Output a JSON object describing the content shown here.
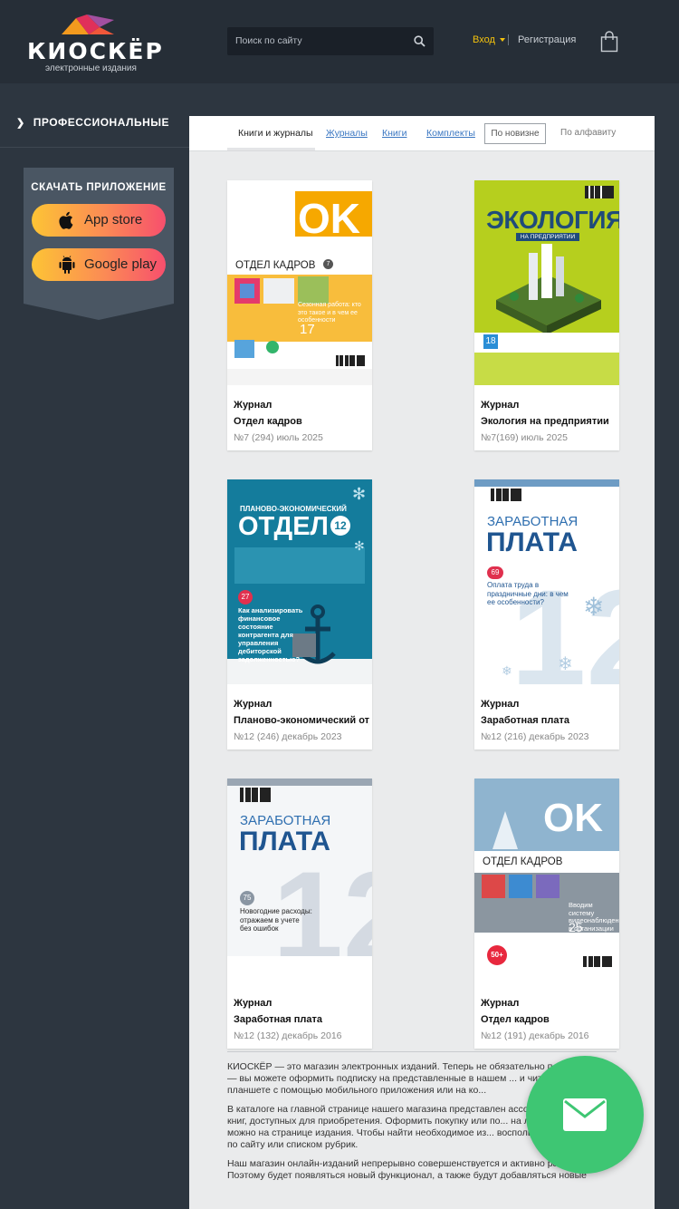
{
  "header": {
    "logo_text": "КИОСКЁР",
    "logo_sub": "электронные издания",
    "search_placeholder": "Поиск по сайту",
    "login": "Вход",
    "register": "Регистрация"
  },
  "sidebar": {
    "category": "ПРОФЕССИОНАЛЬНЫЕ",
    "app_title": "СКАЧАТЬ ПРИЛОЖЕНИЕ",
    "app_store": "App store",
    "google_play": "Google play"
  },
  "tabs": {
    "active": "Книги и журналы",
    "journals": "Журналы",
    "books": "Книги",
    "kits": "Комплекты",
    "sort_new": "По новизне",
    "sort_alpha": "По алфавиту"
  },
  "products": [
    {
      "type": "Журнал",
      "title": "Отдел кадров",
      "issue": "№7 (294) июль 2025",
      "cover": {
        "brand": "ОК",
        "name": "ОТДЕЛ КАДРОВ",
        "number": "7",
        "feature_num": "17",
        "feature": "Сезонная работа: кто это такое и в чем ее особенности"
      }
    },
    {
      "type": "Журнал",
      "title": "Экология на предприятии",
      "issue": "№7(169) июль 2025",
      "cover": {
        "name": "ЭКОЛОГИЯ",
        "sub": "НА ПРЕДПРИЯТИИ",
        "feature_num": "18"
      }
    },
    {
      "type": "Журнал",
      "title": "Планово-экономический отдел",
      "issue": "№12 (246) декабрь 2023",
      "cover": {
        "name_top": "ПЛАНОВО-ЭКОНОМИЧЕСКИЙ",
        "name": "ОТДЕЛ",
        "number": "12",
        "feature_num": "27",
        "feature": "Как анализировать финансовое состояние контрагента для управления дебиторской задолженностью?"
      }
    },
    {
      "type": "Журнал",
      "title": "Заработная плата",
      "issue": "№12 (216) декабрь 2023",
      "cover": {
        "name_a": "ЗАРАБОТНАЯ",
        "name_b": "ПЛАТА",
        "feature_num": "69",
        "feature": "Оплата труда в праздничные дни: в чем ее особенности?"
      }
    },
    {
      "type": "Журнал",
      "title": "Заработная плата",
      "issue": "№12 (132) декабрь 2016",
      "cover": {
        "name_a": "ЗАРАБОТНАЯ",
        "name_b": "ПЛАТА",
        "feature_num": "75",
        "feature": "Новогодние расходы: отражаем в учете без ошибок"
      }
    },
    {
      "type": "Журнал",
      "title": "Отдел кадров",
      "issue": "№12 (191) декабрь 2016",
      "cover": {
        "brand": "ОК",
        "name": "ОТДЕЛ КАДРОВ",
        "feature_num": "25",
        "feature": "Вводим систему видеонаблюдения в организации",
        "badge": "50+"
      }
    }
  ],
  "about": [
    "КИОСКЁР — это магазин электронных изданий. Теперь не обязательно п... отделения — вы можете оформить подписку на представленные в нашем ... и читать их на планшете с помощью мобильного приложения или на ко...",
    "В каталоге на главной странице нашего магазина представлен ассортим... журналов и книг, доступных для приобретения. Оформить покупку или по... на любой период можно на странице издания. Чтобы найти необходимое из... воспользуйтесь поиском по сайту или списком рубрик.",
    "Наш магазин онлайн-изданий непрерывно совершенствуется и активно развивается. Поэтому будет появляться новый функционал, а также будут добавляться новые"
  ],
  "colors": {
    "header_bg": "#262e37",
    "page_bg": "#2d3640",
    "accent_yellow": "#f4c20d",
    "link_blue": "#3a77c2",
    "fab_green": "#3ec673"
  }
}
